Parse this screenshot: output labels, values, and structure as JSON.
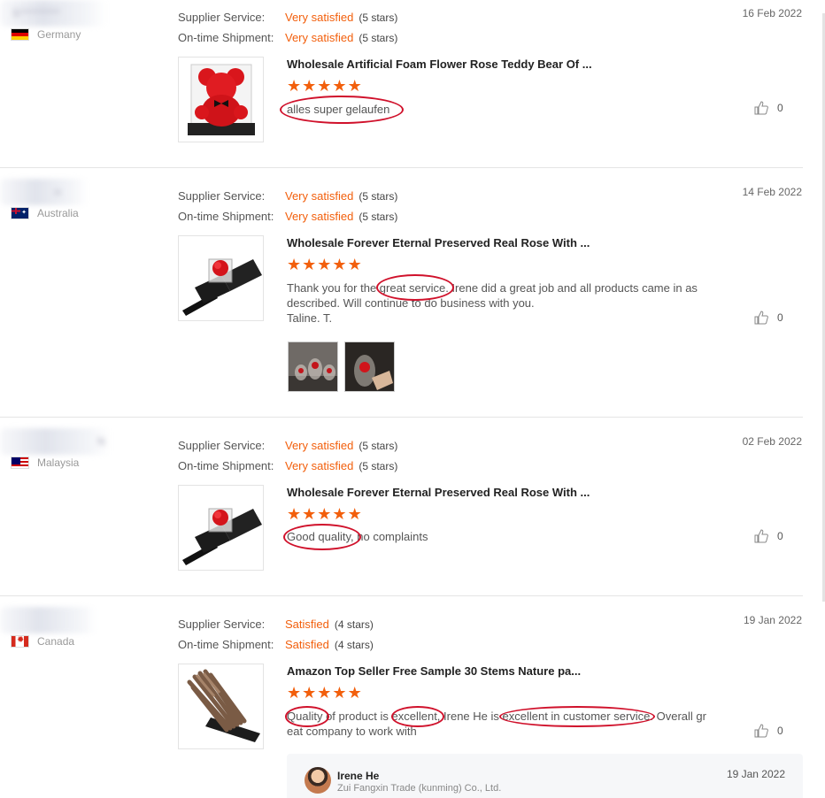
{
  "labels": {
    "supplier_service": "Supplier Service:",
    "on_time_shipment": "On-time Shipment:"
  },
  "reviews": [
    {
      "buyer_name_obscured": "S********",
      "country": "Germany",
      "supplier_service_value": "Very satisfied",
      "supplier_service_stars": "(5 stars)",
      "shipment_value": "Very satisfied",
      "shipment_stars": "(5 stars)",
      "date": "16 Feb 2022",
      "product_title": "Wholesale Artificial Foam Flower Rose Teddy Bear Of ...",
      "rating": 5,
      "comment_lines": [
        "alles super gelaufen"
      ],
      "likes": "0"
    },
    {
      "buyer_name_obscured": "n",
      "country": "Australia",
      "supplier_service_value": "Very satisfied",
      "supplier_service_stars": "(5 stars)",
      "shipment_value": "Very satisfied",
      "shipment_stars": "(5 stars)",
      "date": "14 Feb 2022",
      "product_title": "Wholesale Forever Eternal Preserved Real Rose With ...",
      "rating": 5,
      "comment_lines": [
        "Thank you for the great service. Irene did a great job and all products came in as",
        "described. Will continue to do business with you.",
        "Taline. T."
      ],
      "likes": "0"
    },
    {
      "buyer_name_obscured": "N",
      "country": "Malaysia",
      "supplier_service_value": "Very satisfied",
      "supplier_service_stars": "(5 stars)",
      "shipment_value": "Very satisfied",
      "shipment_stars": "(5 stars)",
      "date": "02 Feb 2022",
      "product_title": "Wholesale Forever Eternal Preserved Real Rose With ...",
      "rating": 5,
      "comment_lines": [
        "Good quality, no complaints"
      ],
      "likes": "0"
    },
    {
      "buyer_name_obscured": "",
      "country": "Canada",
      "supplier_service_value": "Satisfied",
      "supplier_service_stars": "(4 stars)",
      "shipment_value": "Satisfied",
      "shipment_stars": "(4 stars)",
      "date": "19 Jan 2022",
      "product_title": "Amazon Top Seller Free Sample 30 Stems Nature pa...",
      "rating": 5,
      "comment_lines": [
        "Quality of product is excellent, Irene He is excellent in customer service. Overall gr",
        "eat company to work with"
      ],
      "likes": "0"
    }
  ],
  "supplier_reply": {
    "name": "Irene He",
    "company": "Zui Fangxin Trade (kunming) Co., Ltd.",
    "date": "19 Jan 2022"
  },
  "colors": {
    "accent": "#f25f0c",
    "annotation": "#d0112b"
  }
}
